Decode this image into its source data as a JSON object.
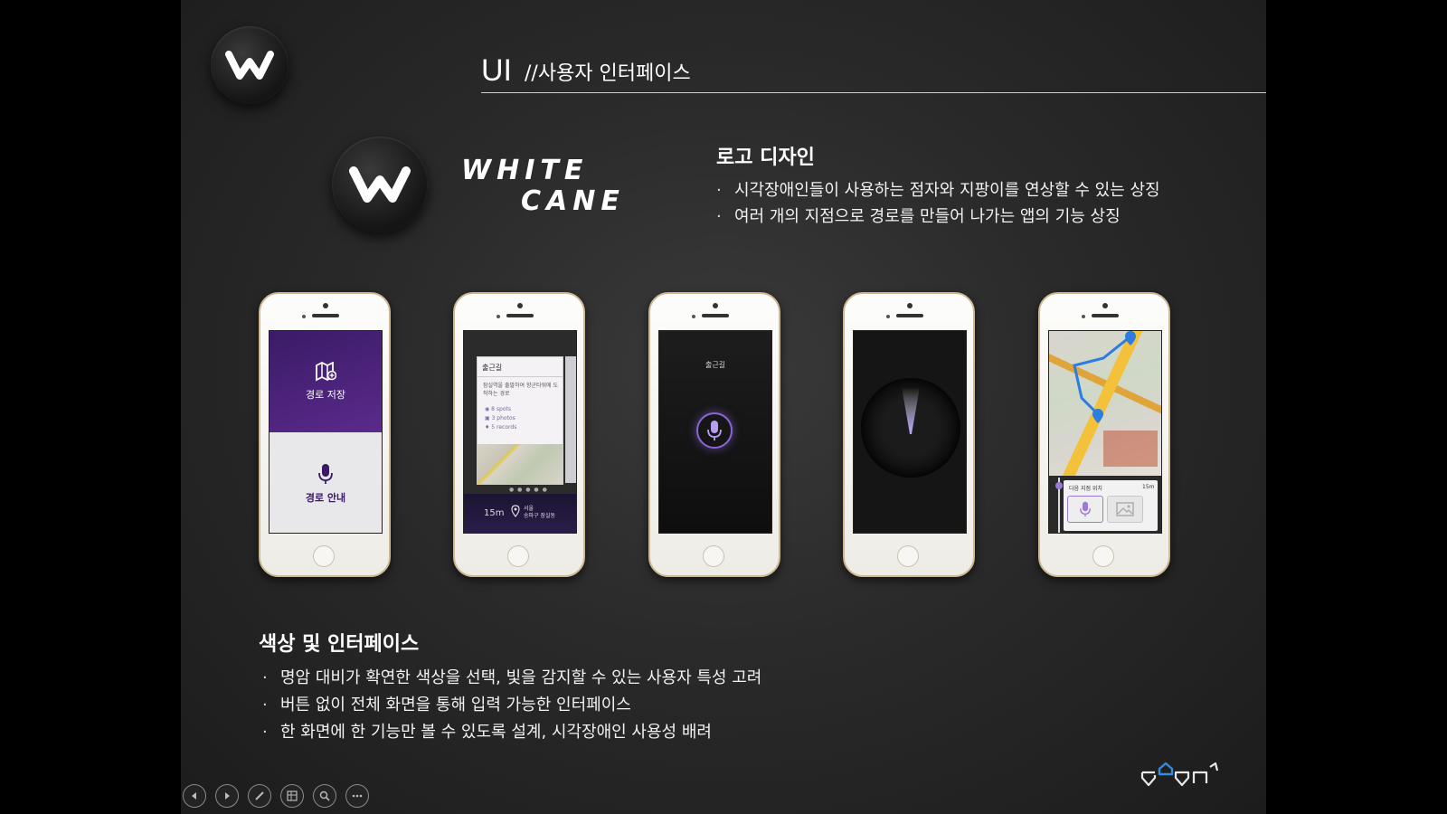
{
  "header": {
    "title_ui": "UI",
    "title_sub": "//사용자 인터페이스"
  },
  "logo_section": {
    "heading": "로고 디자인",
    "bullets": [
      "시각장애인들이 사용하는 점자와 지팡이를 연상할 수 있는 상징",
      "여러 개의 지점으로 경로를 만들어 나가는 앱의 기능 상징"
    ],
    "wordmark_line1": "WHITE",
    "wordmark_line2": "CANE"
  },
  "phones": {
    "p1": {
      "top_label": "경로 저장",
      "bottom_label": "경로 안내"
    },
    "p2": {
      "card_title": "출근길",
      "card_desc": "잠실역을 출발하여 향군타워에 도착하는 경로",
      "stat_spots": "8 spots",
      "stat_photos": "3 photos",
      "stat_records": "5 records",
      "distance": "15m",
      "place_line1": "서울",
      "place_line2": "송파구 잠실동",
      "pager": "● ● ● ● ●"
    },
    "p3": {
      "label": "출근길"
    },
    "p5": {
      "next_label": "다음 지점 위치",
      "next_dist": "15m"
    }
  },
  "color_section": {
    "heading": "색상 및 인터페이스",
    "bullets": [
      "명암 대비가 확연한 색상을 선택, 빛을 감지할 수 있는 사용자 특성 고려",
      "버튼 없이 전체 화면을 통해 입력 가능한 인터페이스",
      "한 화면에 한 기능만 볼 수 있도록 설계, 시각장애인 사용성 배려"
    ]
  },
  "colors": {
    "accent_purple": "#5a2a8c",
    "mic_purple": "#8a66d6",
    "background": "#2a2a2a"
  },
  "navbar": {
    "icons": [
      "prev-icon",
      "next-icon",
      "pen-icon",
      "slides-icon",
      "zoom-icon",
      "more-icon"
    ]
  }
}
